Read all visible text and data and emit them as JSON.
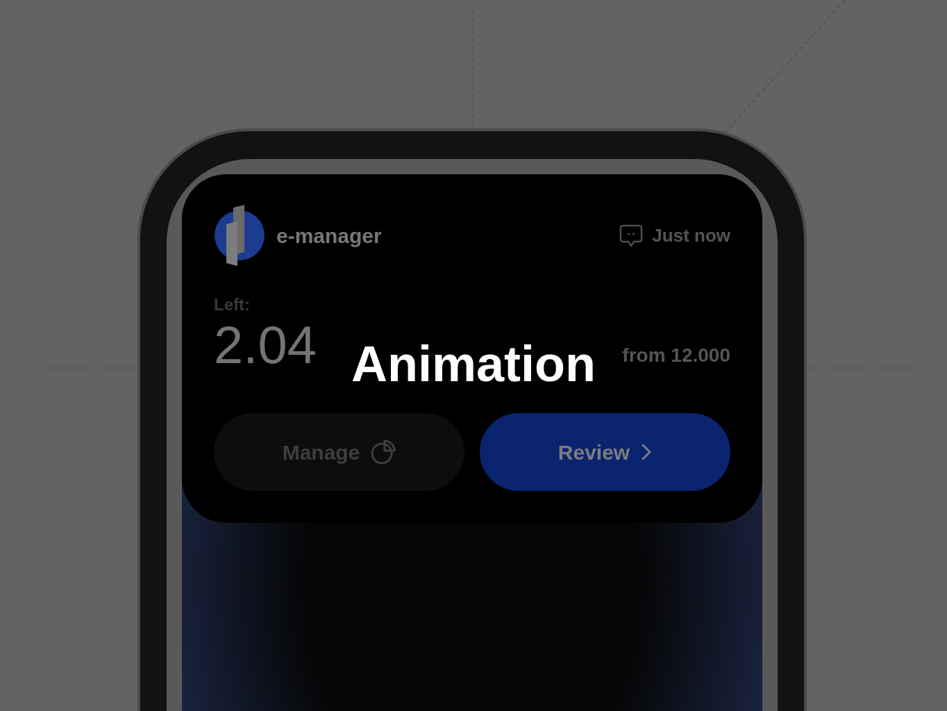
{
  "overlay_title": "Animation",
  "widget": {
    "app_name": "e-manager",
    "time": "Just now",
    "balance_label": "Left:",
    "amount": "2.04",
    "total": "from 12.000",
    "buttons": [
      {
        "label": "Manage",
        "kind": "secondary"
      },
      {
        "label": "Review",
        "kind": "primary"
      }
    ]
  }
}
